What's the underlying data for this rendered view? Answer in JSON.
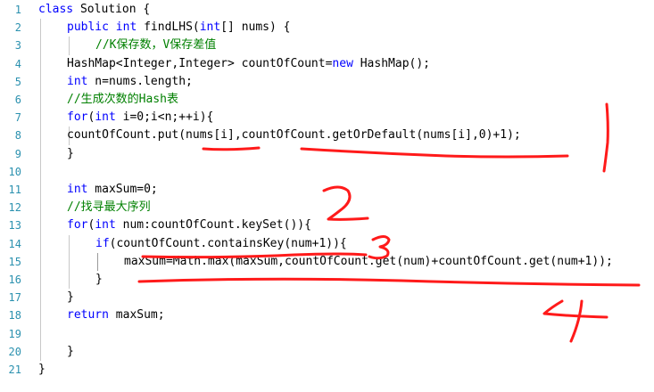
{
  "editor": {
    "line_numbers": [
      "1",
      "2",
      "3",
      "4",
      "5",
      "6",
      "7",
      "8",
      "9",
      "10",
      "11",
      "12",
      "13",
      "14",
      "15",
      "16",
      "17",
      "18",
      "19",
      "20",
      "21"
    ],
    "lines": [
      {
        "n": 1,
        "indent": 0,
        "tokens": [
          {
            "t": "class",
            "c": "kw"
          },
          {
            "t": " Solution {"
          }
        ]
      },
      {
        "n": 2,
        "indent": 1,
        "tokens": [
          {
            "t": "public",
            "c": "kw"
          },
          {
            "t": " "
          },
          {
            "t": "int",
            "c": "kw"
          },
          {
            "t": " findLHS("
          },
          {
            "t": "int",
            "c": "kw"
          },
          {
            "t": "[] nums) {"
          }
        ]
      },
      {
        "n": 3,
        "indent": 2,
        "tokens": [
          {
            "t": "//K保存数，V保存差值",
            "c": "cm"
          }
        ]
      },
      {
        "n": 4,
        "indent": 1,
        "tokens": [
          {
            "t": "HashMap<Integer,Integer> countOfCount="
          },
          {
            "t": "new",
            "c": "kw"
          },
          {
            "t": " HashMap();"
          }
        ]
      },
      {
        "n": 5,
        "indent": 1,
        "tokens": [
          {
            "t": "int",
            "c": "kw"
          },
          {
            "t": " n=nums.length;"
          }
        ]
      },
      {
        "n": 6,
        "indent": 1,
        "tokens": [
          {
            "t": "//生成次数的Hash表",
            "c": "cm"
          }
        ]
      },
      {
        "n": 7,
        "indent": 1,
        "tokens": [
          {
            "t": "for",
            "c": "kw"
          },
          {
            "t": "("
          },
          {
            "t": "int",
            "c": "kw"
          },
          {
            "t": " i=0;i<n;++i){"
          }
        ]
      },
      {
        "n": 8,
        "indent": 1,
        "tokens": [
          {
            "t": "countOfCount.put(nums[i],countOfCount.getOrDefault(nums[i],0)+1);"
          }
        ]
      },
      {
        "n": 9,
        "indent": 1,
        "tokens": [
          {
            "t": "}"
          }
        ]
      },
      {
        "n": 10,
        "indent": 0,
        "tokens": []
      },
      {
        "n": 11,
        "indent": 1,
        "tokens": [
          {
            "t": "int",
            "c": "kw"
          },
          {
            "t": " maxSum=0;"
          }
        ]
      },
      {
        "n": 12,
        "indent": 1,
        "tokens": [
          {
            "t": "//找寻最大序列",
            "c": "cm"
          }
        ]
      },
      {
        "n": 13,
        "indent": 1,
        "tokens": [
          {
            "t": "for",
            "c": "kw"
          },
          {
            "t": "("
          },
          {
            "t": "int",
            "c": "kw"
          },
          {
            "t": " num:countOfCount.keySet()){"
          }
        ]
      },
      {
        "n": 14,
        "indent": 2,
        "tokens": [
          {
            "t": "if",
            "c": "kw"
          },
          {
            "t": "(countOfCount.containsKey(num+1)){"
          }
        ]
      },
      {
        "n": 15,
        "indent": 3,
        "tokens": [
          {
            "t": "maxSum=Math.max(maxSum,countOfCount.get(num)+countOfCount.get(num+1));"
          }
        ]
      },
      {
        "n": 16,
        "indent": 2,
        "tokens": [
          {
            "t": "}"
          }
        ]
      },
      {
        "n": 17,
        "indent": 1,
        "tokens": [
          {
            "t": "}"
          }
        ]
      },
      {
        "n": 18,
        "indent": 1,
        "tokens": [
          {
            "t": "return",
            "c": "kw"
          },
          {
            "t": " maxSum;"
          }
        ]
      },
      {
        "n": 19,
        "indent": 0,
        "tokens": []
      },
      {
        "n": 20,
        "indent": 1,
        "tokens": [
          {
            "t": "}"
          }
        ]
      },
      {
        "n": 21,
        "indent": 0,
        "tokens": [
          {
            "t": "}"
          }
        ]
      }
    ]
  },
  "annotations": {
    "color": "#ff1a1a",
    "numbers": [
      "1",
      "2",
      "3",
      "4"
    ]
  },
  "colors": {
    "keyword": "#0000ff",
    "comment": "#008000",
    "line_number": "#2b91af",
    "text": "#000000",
    "annotation": "#ff1a1a"
  }
}
